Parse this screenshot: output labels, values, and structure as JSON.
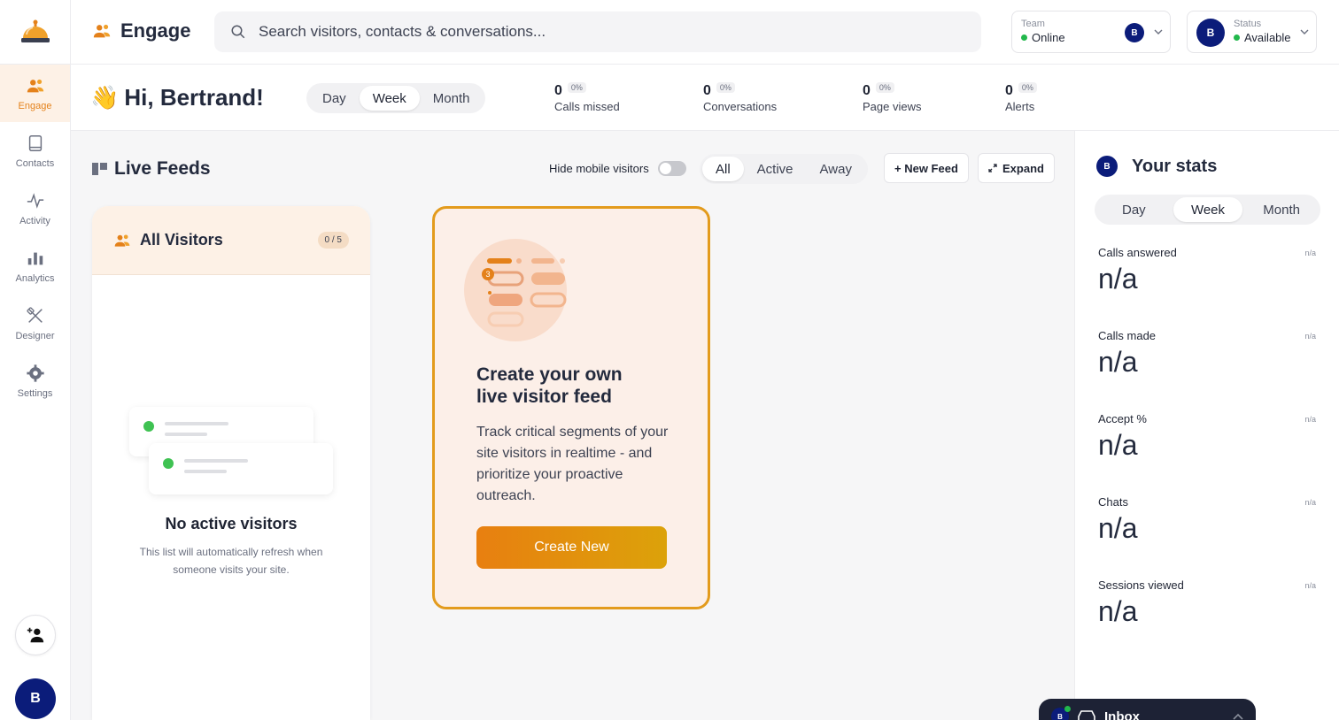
{
  "sidebar": {
    "items": [
      {
        "label": "Engage",
        "icon": "users-icon"
      },
      {
        "label": "Contacts",
        "icon": "book-icon"
      },
      {
        "label": "Activity",
        "icon": "pulse-icon"
      },
      {
        "label": "Analytics",
        "icon": "bar-chart-icon"
      },
      {
        "label": "Designer",
        "icon": "design-tools-icon"
      },
      {
        "label": "Settings",
        "icon": "gear-icon"
      }
    ],
    "avatar_initial": "B"
  },
  "header": {
    "title": "Engage",
    "search_placeholder": "Search visitors, contacts & conversations...",
    "team": {
      "label": "Team",
      "value": "Online",
      "avatar": "B"
    },
    "status": {
      "label": "Status",
      "value": "Available",
      "avatar": "B"
    }
  },
  "greeting": {
    "emoji": "👋",
    "text": "Hi, Bertrand!",
    "periods": [
      "Day",
      "Week",
      "Month"
    ],
    "selected": "Week"
  },
  "metrics": [
    {
      "value": "0",
      "pct": "0%",
      "label": "Calls missed"
    },
    {
      "value": "0",
      "pct": "0%",
      "label": "Conversations"
    },
    {
      "value": "0",
      "pct": "0%",
      "label": "Page views"
    },
    {
      "value": "0",
      "pct": "0%",
      "label": "Alerts"
    }
  ],
  "live_feeds": {
    "title": "Live Feeds",
    "hide_mobile_label": "Hide mobile visitors",
    "filters": [
      "All",
      "Active",
      "Away"
    ],
    "selected_filter": "All",
    "new_feed_label": "+ New Feed",
    "expand_label": "Expand"
  },
  "all_visitors": {
    "title": "All Visitors",
    "count": "0 / 5",
    "empty_title": "No active visitors",
    "empty_desc": "This list will automatically refresh when someone visits your site."
  },
  "create_feed": {
    "badge": "3",
    "title_line1": "Create your own",
    "title_line2": "live visitor feed",
    "description": "Track critical segments of your site visitors in realtime - and prioritize your proactive outreach.",
    "button": "Create New"
  },
  "stats": {
    "avatar": "B",
    "title": "Your stats",
    "periods": [
      "Day",
      "Week",
      "Month"
    ],
    "selected": "Week",
    "rows": [
      {
        "label": "Calls answered",
        "badge": "n/a",
        "value": "n/a"
      },
      {
        "label": "Calls made",
        "badge": "n/a",
        "value": "n/a"
      },
      {
        "label": "Accept %",
        "badge": "n/a",
        "value": "n/a"
      },
      {
        "label": "Chats",
        "badge": "n/a",
        "value": "n/a"
      },
      {
        "label": "Sessions viewed",
        "badge": "n/a",
        "value": "n/a"
      }
    ]
  },
  "inbox": {
    "label": "Inbox",
    "avatar": "B"
  },
  "colors": {
    "accent": "#e4811a",
    "brand_navy": "#0b1c7a",
    "online": "#22b84c"
  }
}
